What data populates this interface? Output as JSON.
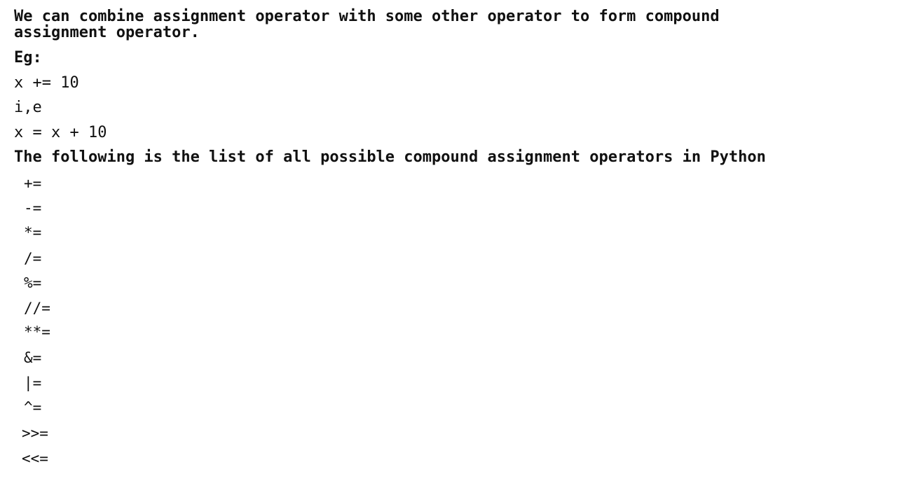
{
  "intro": {
    "line1": "We can combine assignment operator with some other operator to form compound",
    "line2": "assignment operator."
  },
  "example": {
    "label": "Eg:",
    "code": "x += 10",
    "ie": "i,e",
    "expanded": "x = x + 10"
  },
  "list_heading": "The following is the list of all possible compound assignment operators in Python",
  "operators": [
    "+=",
    "-=",
    "*=",
    "/=",
    "%=",
    "//=",
    "**=",
    "&=",
    "|=",
    "^=",
    ">>=",
    "<<="
  ]
}
